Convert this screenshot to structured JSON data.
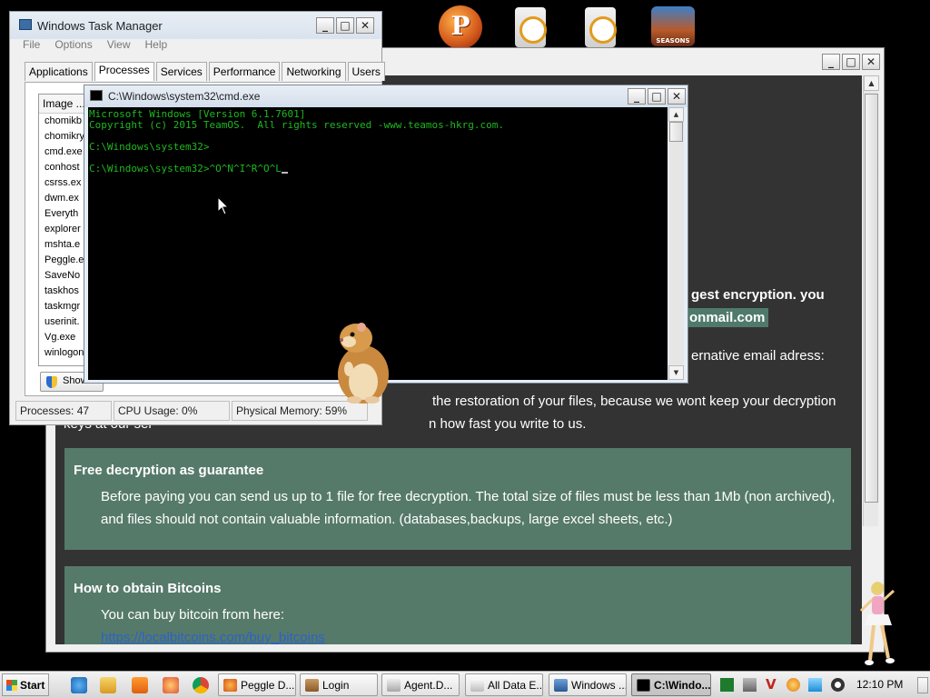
{
  "desktop": {
    "peggle_icon_letter": "P",
    "angry_birds_icon_text": "SEASONS"
  },
  "ransom": {
    "line1": "gest encryption. you",
    "email": "onmail.com",
    "line2": "ernative email adress:",
    "line3": "the restoration of your files, because we wont keep your decryption",
    "line4_left": "keys at our ser",
    "line4_right": "n how fast you write to us.",
    "free_decryption": {
      "heading": "Free decryption as guarantee",
      "line1": "Before paying you can send us up to 1 file for free decryption. The total size of files must be less than 1Mb (non archived),",
      "line2": "and files should not contain valuable information. (databases,backups, large excel sheets, etc.)"
    },
    "bitcoins": {
      "heading": "How to obtain Bitcoins",
      "line1": "You can buy bitcoin from here:",
      "link": "https://localbitcoins.com/buy_bitcoins"
    }
  },
  "taskmgr": {
    "title": "Windows Task Manager",
    "menu": [
      "File",
      "Options",
      "View",
      "Help"
    ],
    "tabs": [
      "Applications",
      "Processes",
      "Services",
      "Performance",
      "Networking",
      "Users"
    ],
    "active_tab": "Processes",
    "column_header": "Image ...",
    "processes": [
      "chomikb",
      "chomikry",
      "cmd.exe",
      "conhost",
      "csrss.ex",
      "dwm.ex",
      "Everyth",
      "explorer",
      "mshta.e",
      "Peggle.e",
      "SaveNo",
      "taskhos",
      "taskmgr",
      "userinit.",
      "Vg.exe",
      "winlogon"
    ],
    "show_button": "Show",
    "status": {
      "processes": "Processes: 47",
      "cpu": "CPU Usage: 0%",
      "memory": "Physical Memory: 59%"
    }
  },
  "cmd": {
    "title": "C:\\Windows\\system32\\cmd.exe",
    "lines": [
      "Microsoft Windows [Version 6.1.7601]",
      "Copyright (c) 2015 TeamOS.  All rights reserved -www.teamos-hkrg.com.",
      "C:\\Windows\\system32>",
      "C:\\Windows\\system32>^O^N^I^R^O^L"
    ]
  },
  "taskbar": {
    "start_label": "Start",
    "buttons": [
      "Peggle D...",
      "Login",
      "Agent.D...",
      "All Data E...",
      "Windows ...",
      "C:\\Windo..."
    ],
    "active_button": "C:\\Windo...",
    "clock": "12:10 PM"
  },
  "colors": {
    "console_text": "#1fb81f",
    "ransom_bg": "#333333",
    "ransom_box": "#567a6a",
    "link": "#2a63c8"
  }
}
